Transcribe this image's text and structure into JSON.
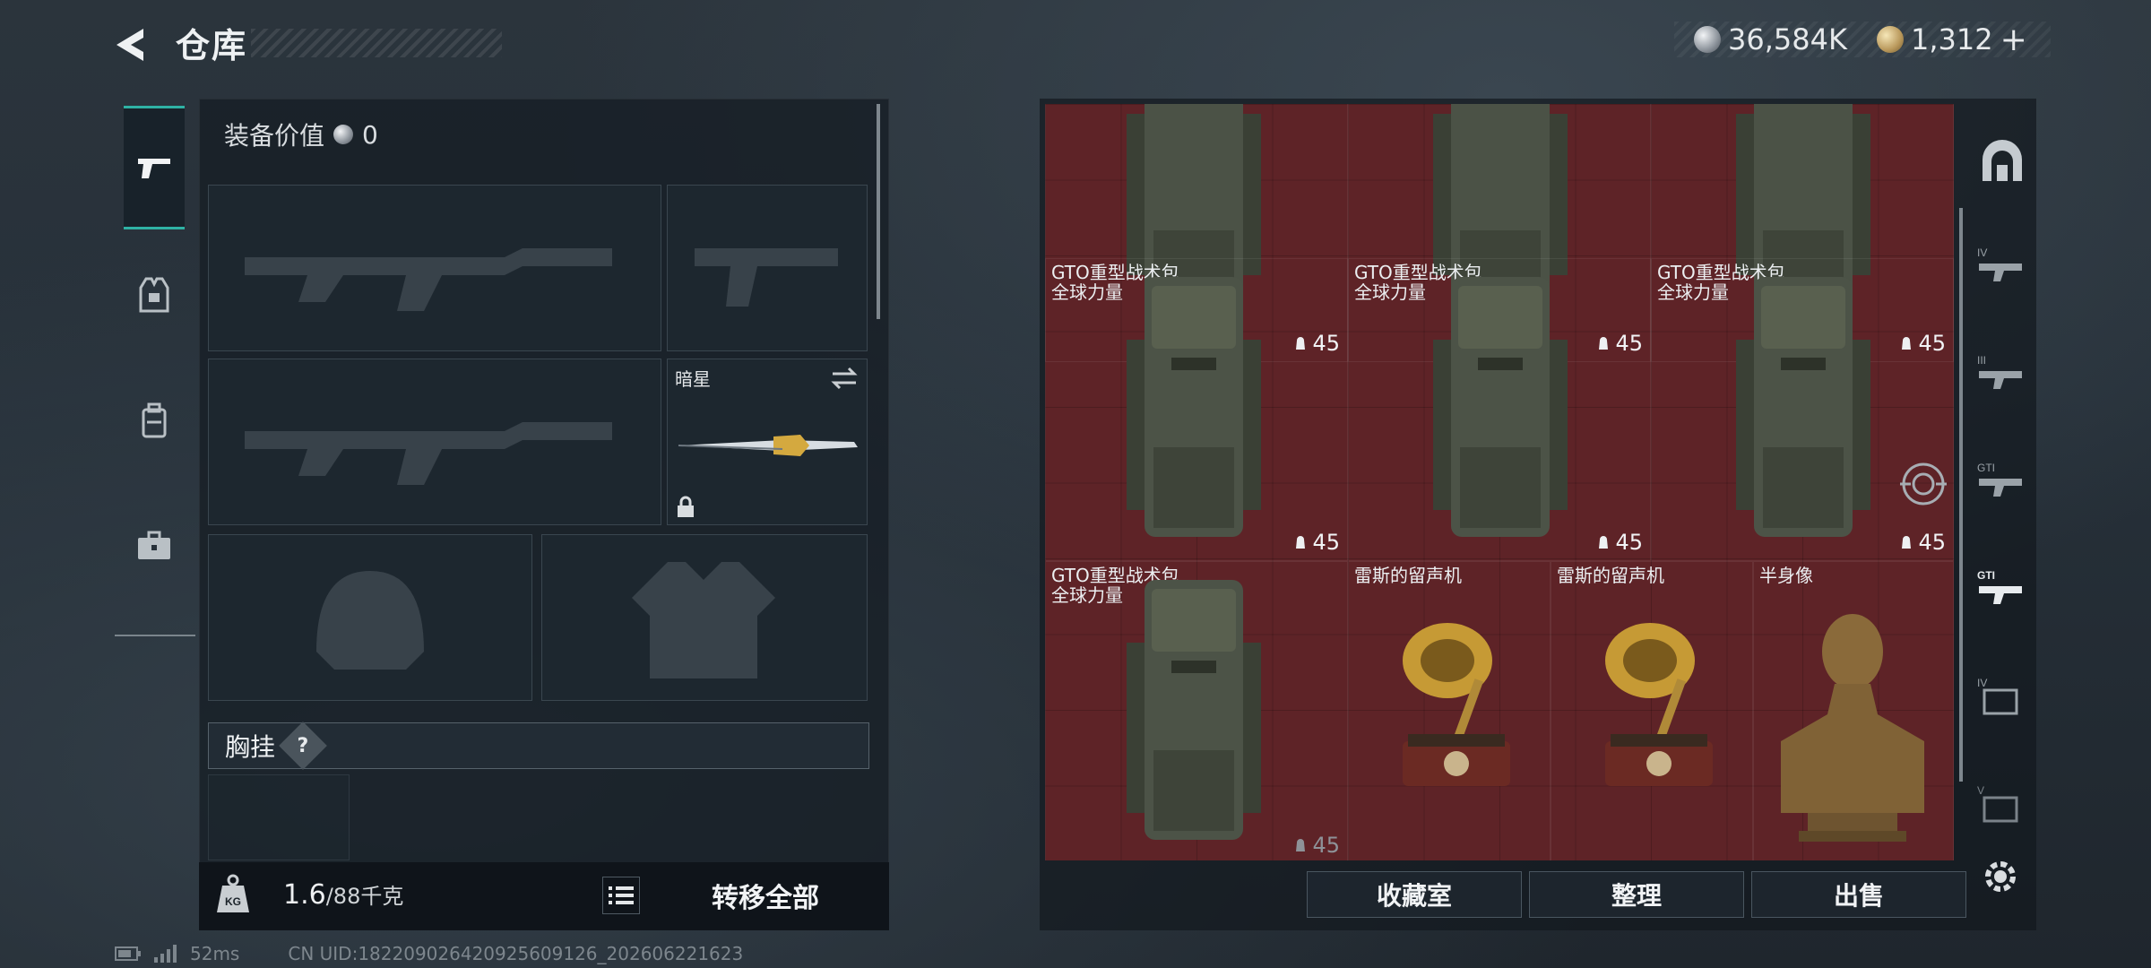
{
  "header": {
    "title": "仓库",
    "currency_silver": "36,584K",
    "currency_gold": "1,312",
    "add_label": "+"
  },
  "equipment": {
    "value_label": "装备价值",
    "value": "0",
    "melee_name": "暗星",
    "chest_label": "胸挂",
    "help": "?",
    "weight_current": "1.6",
    "weight_max": "/88千克",
    "transfer_all": "转移全部"
  },
  "storage": {
    "items": [
      {
        "name": "",
        "sub": "",
        "durability": "45"
      },
      {
        "name": "",
        "sub": "",
        "durability": "45"
      },
      {
        "name": "",
        "sub": "",
        "durability": "45"
      },
      {
        "name": "GTO重型战术包",
        "sub": "全球力量",
        "durability": "45"
      },
      {
        "name": "GTO重型战术包",
        "sub": "全球力量",
        "durability": "45"
      },
      {
        "name": "GTO重型战术包",
        "sub": "全球力量",
        "durability": "45"
      },
      {
        "name": "GTO重型战术包",
        "sub": "全球力量",
        "durability": "45"
      },
      {
        "name": "雷斯的留声机",
        "sub": ""
      },
      {
        "name": "雷斯的留声机",
        "sub": ""
      },
      {
        "name": "半身像",
        "sub": ""
      }
    ]
  },
  "actions": {
    "collection": "收藏室",
    "sort": "整理",
    "sell": "出售"
  },
  "status": {
    "ping": "52ms",
    "uid": "CN UID:1822090264209256091​26_202606221623"
  },
  "colors": {
    "accent": "#2fb2a4",
    "storage_bg": "#5e2327"
  }
}
